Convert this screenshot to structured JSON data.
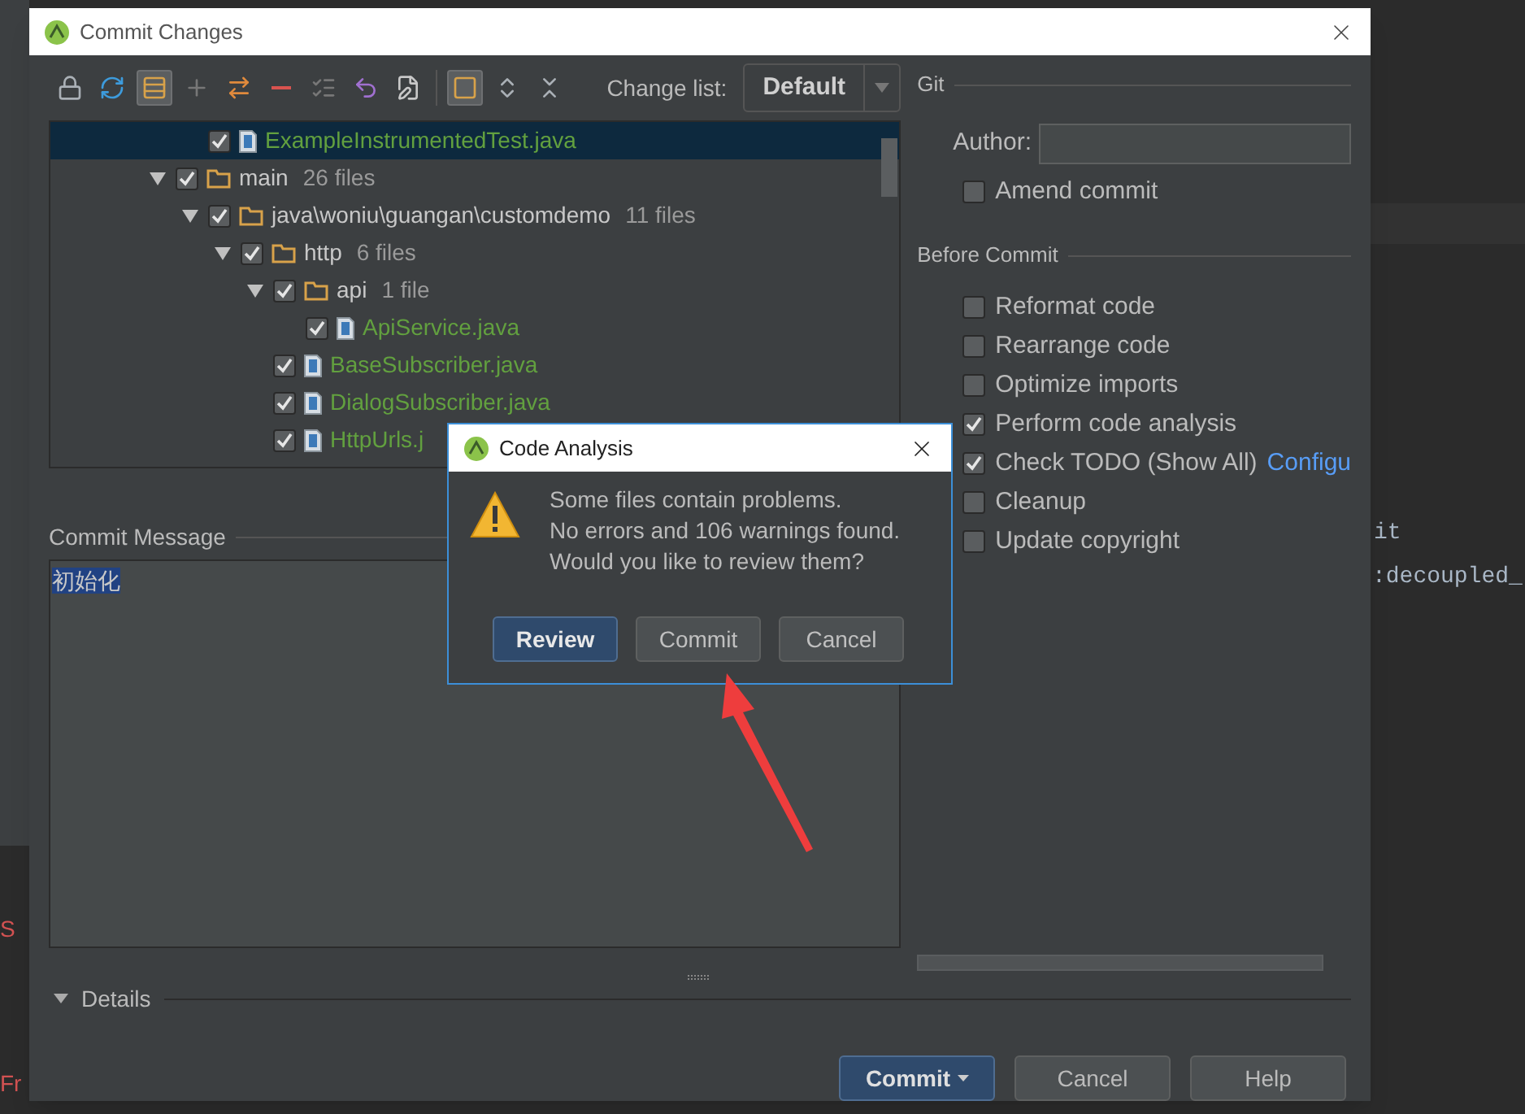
{
  "background_editor": {
    "right_lines": [
      "it",
      ":decoupled_"
    ],
    "left_lines": [
      "S",
      "Fr"
    ]
  },
  "window": {
    "title": "Commit Changes"
  },
  "toolbar": [
    {
      "kind": "shelve",
      "on": false
    },
    {
      "kind": "refresh",
      "on": false
    },
    {
      "kind": "group",
      "on": true
    },
    {
      "kind": "add",
      "on": false
    },
    {
      "kind": "move",
      "on": false
    },
    {
      "kind": "remove",
      "on": false
    },
    {
      "kind": "select",
      "on": false
    },
    {
      "kind": "revert",
      "on": false
    },
    {
      "kind": "edit",
      "on": false
    },
    {
      "kind": "module",
      "on": true
    },
    {
      "kind": "expand",
      "on": false
    },
    {
      "kind": "collapse",
      "on": false
    }
  ],
  "change_list": {
    "label": "Change list:",
    "value": "Default"
  },
  "tree": [
    {
      "kind": "file",
      "label": "ExampleInstrumentedTest.java",
      "checked": true,
      "selected": true
    },
    {
      "kind": "folder",
      "label": "main",
      "count": "26 files",
      "checked": true,
      "selected": false,
      "expanded": true,
      "children": [
        {
          "kind": "folder",
          "label": "java\\woniu\\guangan\\customdemo",
          "count": "11 files",
          "checked": true,
          "selected": false,
          "expanded": true,
          "children": [
            {
              "kind": "folder",
              "label": "http",
              "count": "6 files",
              "checked": true,
              "selected": false,
              "expanded": true,
              "children": [
                {
                  "kind": "folder",
                  "label": "api",
                  "count": "1 file",
                  "checked": true,
                  "selected": false,
                  "expanded": true,
                  "children": [
                    {
                      "kind": "file",
                      "label": "ApiService.java",
                      "checked": true,
                      "selected": false
                    }
                  ]
                },
                {
                  "kind": "file",
                  "label": "BaseSubscriber.java",
                  "checked": true,
                  "selected": false
                },
                {
                  "kind": "file",
                  "label": "DialogSubscriber.java",
                  "checked": true,
                  "selected": false
                },
                {
                  "kind": "file",
                  "label": "HttpUrls.j",
                  "checked": true,
                  "selected": false
                }
              ]
            }
          ]
        }
      ]
    }
  ],
  "commit_message": {
    "label": "Commit Message",
    "value": "初始化"
  },
  "details": {
    "label": "Details",
    "expanded": true
  },
  "git": {
    "header": "Git",
    "author_label": "Author:",
    "amend": {
      "label": "Amend commit",
      "checked": false
    }
  },
  "before_commit": {
    "header": "Before Commit",
    "options": [
      {
        "label": "Reformat code",
        "checked": false
      },
      {
        "label": "Rearrange code",
        "checked": false
      },
      {
        "label": "Optimize imports",
        "checked": false
      },
      {
        "label": "Perform code analysis",
        "checked": true
      },
      {
        "label": "Check TODO (Show All)",
        "checked": true,
        "link": "Configu"
      },
      {
        "label": "Cleanup",
        "checked": false
      },
      {
        "label": "Update copyright",
        "checked": false
      }
    ]
  },
  "buttons": [
    {
      "label": "Commit",
      "kind": "primary"
    },
    {
      "label": "Cancel",
      "kind": "normal"
    },
    {
      "label": "Help",
      "kind": "normal"
    }
  ],
  "code_analysis": {
    "title": "Code Analysis",
    "message": [
      "Some files contain problems.",
      "No errors and 106 warnings found.",
      "Would you like to review them?"
    ],
    "buttons": [
      {
        "label": "Review",
        "kind": "primary"
      },
      {
        "label": "Commit",
        "kind": "normal"
      },
      {
        "label": "Cancel",
        "kind": "normal"
      }
    ]
  }
}
